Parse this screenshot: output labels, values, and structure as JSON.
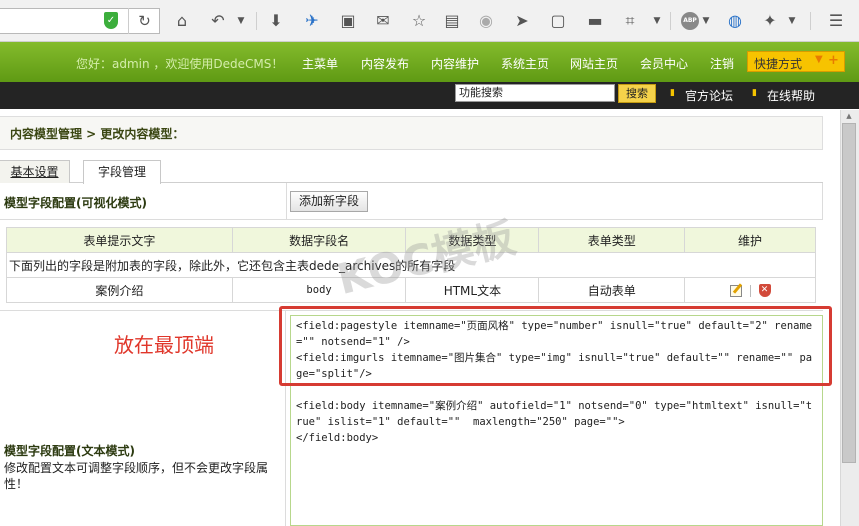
{
  "browser": {
    "icons": [
      "shield-icon",
      "reload-icon",
      "home-icon",
      "back-icon",
      "download-icon",
      "bird-icon",
      "reader-icon",
      "mail-icon",
      "star-icon",
      "bookmarks-icon",
      "rss-icon",
      "send-icon",
      "window-icon",
      "folder-icon",
      "crop-icon",
      "abp-icon",
      "globe-icon",
      "tool-icon",
      "menu-icon"
    ],
    "abp_label": "ABP"
  },
  "header": {
    "welcome": "您好：admin ，欢迎使用DedeCMS！",
    "nav": [
      "主菜单",
      "内容发布",
      "内容维护",
      "系统主页",
      "网站主页",
      "会员中心",
      "注销"
    ],
    "quick": "快捷方式"
  },
  "topbar": {
    "search_value": "功能搜索",
    "search_button": "搜索",
    "links": [
      "官方论坛",
      "在线帮助"
    ]
  },
  "breadcrumb": "内容模型管理 > 更改内容模型：",
  "tabs": [
    "基本设置",
    "字段管理"
  ],
  "visual_section": {
    "title": "模型字段配置(可视化模式)",
    "add_button": "添加新字段"
  },
  "table": {
    "headers": [
      "表单提示文字",
      "数据字段名",
      "数据类型",
      "表单类型",
      "维护"
    ],
    "note": "下面列出的字段是附加表的字段，除此外，它还包含主表dede_archives的所有字段",
    "rows": [
      {
        "label": "案例介绍",
        "field": "body",
        "type": "HTML文本",
        "form": "自动表单"
      }
    ]
  },
  "annotation": "放在最顶端",
  "text_section": {
    "title": "模型字段配置(文本模式)",
    "desc": "修改配置文本可调整字段顺序，但不会更改字段属性！"
  },
  "code": {
    "block1": "<field:pagestyle itemname=\"页面风格\" type=\"number\" isnull=\"true\" default=\"2\" rename=\"\" notsend=\"1\" />\n<field:imgurls itemname=\"图片集合\" type=\"img\" isnull=\"true\" default=\"\" rename=\"\" page=\"split\"/>",
    "block2": "<field:body itemname=\"案例介绍\" autofield=\"1\" notsend=\"0\" type=\"htmltext\" isnull=\"true\" islist=\"1\" default=\"\"  maxlength=\"250\" page=\"\">\n</field:body>"
  },
  "watermark": "KOC模板"
}
